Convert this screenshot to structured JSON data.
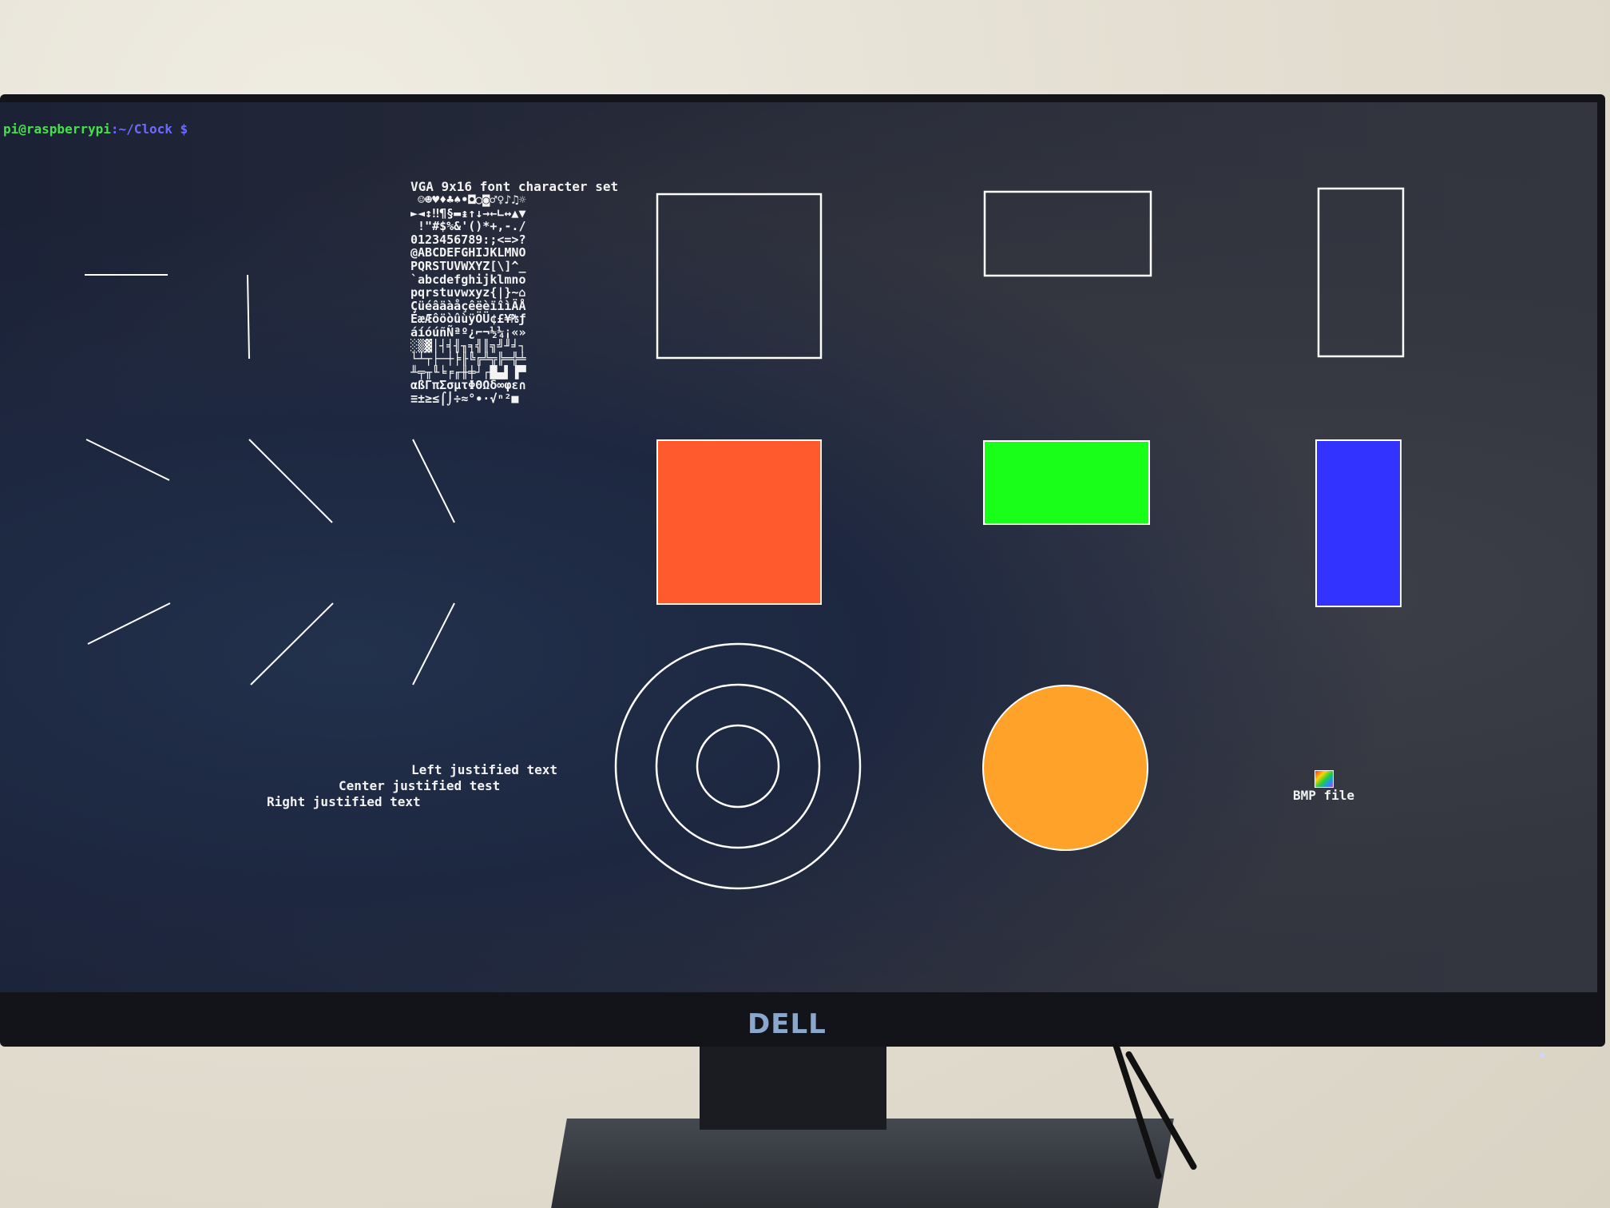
{
  "terminal": {
    "prompt_user": "pi@raspberrypi",
    "prompt_path": ":~/Clock $"
  },
  "font_demo": {
    "title": "VGA 9x16 font character set",
    "rows": [
      " ☺☻♥♦♣♠•◘○◙♂♀♪♫☼",
      "►◄↕‼¶§▬↨↑↓→←∟↔▲▼",
      " !\"#$%&'()*+,-./",
      "0123456789:;<=>?",
      "@ABCDEFGHIJKLMNO",
      "PQRSTUVWXYZ[\\]^_",
      "`abcdefghijklmno",
      "pqrstuvwxyz{|}~⌂",
      "ÇüéâäàåçêëèïîìÄÅ",
      "ÉæÆôöòûùÿÖÜ¢£¥₧ƒ",
      "áíóúñÑªº¿⌐¬½¼¡«»",
      "░▒▓│┤╡╢╖╕╣║╗╝╜╛┐",
      "└┴┬├─┼╞╟╚╔╩╦╠═╬╧",
      "╨╤╥╙╘╒╓╫╪┘┌█▄▌▐▀",
      "αßΓπΣσµτΦΘΩδ∞φε∩",
      "≡±≥≤⌠⌡÷≈°∙·√ⁿ²■ "
    ]
  },
  "text_demo": {
    "left": "Left justified text",
    "center": "Center justified test",
    "right": "Right justified text"
  },
  "bmp": {
    "label": "BMP file"
  },
  "shapes": {
    "fill_colors": {
      "square": "#ff5a2e",
      "rect_wide": "#1aff1a",
      "rect_tall": "#3333ff",
      "circle": "#ffa22a"
    },
    "outline_color": "#ffffff"
  },
  "monitor": {
    "brand": "DELL"
  }
}
